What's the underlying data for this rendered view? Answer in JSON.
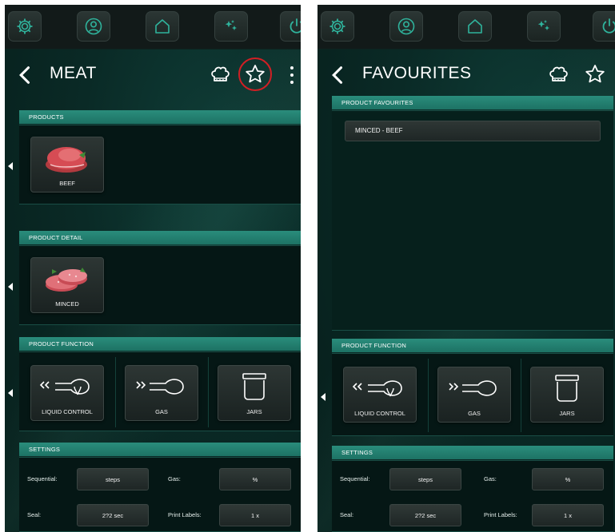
{
  "left_screen": {
    "title": "MEAT",
    "sections": {
      "products": "PRODUCTS",
      "product_detail": "PRODUCT DETAIL",
      "product_function": "PRODUCT FUNCTION",
      "settings": "SETTINGS"
    },
    "products": [
      {
        "label": "BEEF",
        "icon": "beef-image"
      }
    ],
    "product_details": [
      {
        "label": "MINCED",
        "icon": "minced-patty-image"
      }
    ],
    "functions": [
      {
        "label": "LIQUID CONTROL",
        "icon": "liquid-control-icon"
      },
      {
        "label": "GAS",
        "icon": "gas-icon"
      },
      {
        "label": "JARS",
        "icon": "jar-icon"
      }
    ],
    "settings": {
      "sequential_label": "Sequential:",
      "sequential_value": "steps",
      "gas_label": "Gas:",
      "gas_value": "%",
      "seal_label": "Seal:",
      "seal_value": "2?2 sec",
      "print_labels_label": "Print Labels:",
      "print_labels_value": "1 x"
    },
    "highlight_color": "#d11f24"
  },
  "right_screen": {
    "title": "FAVOURITES",
    "sections": {
      "product_favourites": "PRODUCT FAVOURITES",
      "product_function": "PRODUCT FUNCTION",
      "settings": "SETTINGS"
    },
    "favourites": [
      {
        "label": "MINCED - BEEF"
      }
    ],
    "functions": [
      {
        "label": "LIQUID CONTROL",
        "icon": "liquid-control-icon"
      },
      {
        "label": "GAS",
        "icon": "gas-icon"
      },
      {
        "label": "JARS",
        "icon": "jar-icon"
      }
    ],
    "settings": {
      "sequential_label": "Sequential:",
      "sequential_value": "steps",
      "gas_label": "Gas:",
      "gas_value": "%",
      "seal_label": "Seal:",
      "seal_value": "2?2 sec",
      "print_labels_label": "Print Labels:",
      "print_labels_value": "1 x"
    }
  },
  "top_nav_icons": [
    "gear-icon",
    "user-icon",
    "home-icon",
    "sparkle-icon",
    "power-icon"
  ],
  "colors": {
    "accent": "#1d7264",
    "background": "#0a2a26",
    "icon": "#2fb39c"
  }
}
